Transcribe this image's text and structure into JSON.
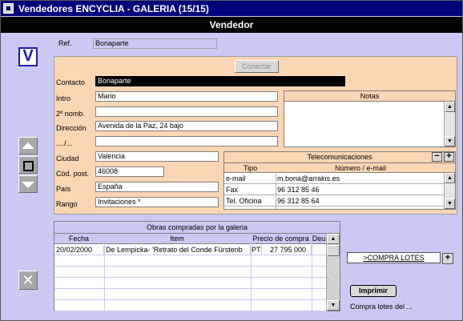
{
  "window": {
    "title": "Vendedores ENCYCLIA - GALERIA (15/15)"
  },
  "header": {
    "title": "Vendedor"
  },
  "ref": {
    "label": "Ref.",
    "value": "Bonaparte"
  },
  "conectar": {
    "label": "Conectar"
  },
  "v_button": {
    "label": "V"
  },
  "form": {
    "contacto": {
      "label": "Contacto",
      "value": "Bonaparte"
    },
    "intro": {
      "label": "Intro",
      "value": "Mario"
    },
    "nomb2": {
      "label": "2º nomb.",
      "value": ""
    },
    "direccion": {
      "label": "Dirección",
      "value": "Avenida de la Paz, 24 bajo"
    },
    "dir2": {
      "label": "..../...",
      "value": ""
    },
    "ciudad": {
      "label": "Ciudad",
      "value": "Valencia"
    },
    "codpost": {
      "label": "Cód. post.",
      "value": "46008"
    },
    "pais": {
      "label": "País",
      "value": "España"
    },
    "rango": {
      "label": "Rango",
      "value": "Invitaciones *"
    }
  },
  "notas": {
    "title": "Notas",
    "value": ""
  },
  "telecom": {
    "title": "Telecomunicaciones",
    "col_tipo": "Tipo",
    "col_numero": "Número / e-mail",
    "rows": [
      {
        "tipo": "e-mail",
        "numero": "m.bona@arrakis.es"
      },
      {
        "tipo": "Fax",
        "numero": "96 312 85 46"
      },
      {
        "tipo": "Tel. Oficina",
        "numero": "96 312 85 64"
      }
    ],
    "minus": "−",
    "plus": "+"
  },
  "obras": {
    "title": "Obras compradas por la galeria",
    "columns": [
      "Fecha",
      "Item",
      "Precio de compra",
      "Deu"
    ],
    "rows": [
      {
        "fecha": "20/02/2000",
        "item": "De Lempicka- 'Retrato del Conde Fürstenb",
        "moneda": "PT",
        "precio": "27 795 000",
        "deu": ""
      }
    ]
  },
  "compra_lotes": {
    "label": ">COMPRA LOTES",
    "plus": "+"
  },
  "imprimir": {
    "label": "Imprimir"
  },
  "compra_lotes_del": {
    "label": "Compra lotes del ..."
  },
  "colors": {
    "title_bar": "#00007b",
    "header": "#000000",
    "background": "#c9c9f3",
    "panel": "#fad6b5"
  }
}
